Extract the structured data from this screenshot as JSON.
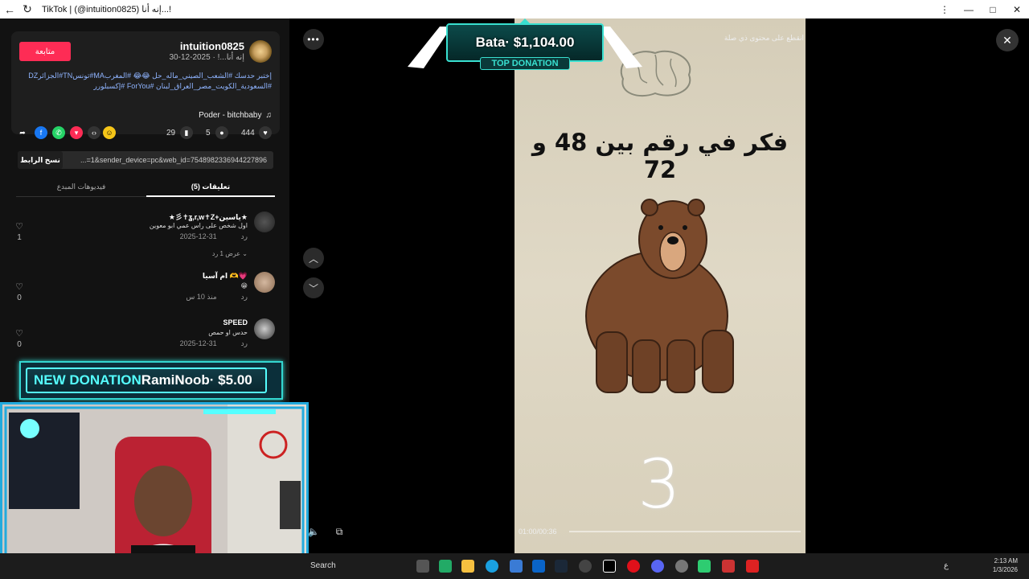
{
  "window": {
    "title": "TikTok | (@intuition0825) إنه أنا...!",
    "back": "←",
    "refresh": "↻",
    "more": "⋮",
    "min": "—",
    "max": "□",
    "close": "✕"
  },
  "post": {
    "follow_label": "متابعة",
    "username": "intuition0825",
    "date_line": "إنه أنا...! · 2025-12-30",
    "description_text": "إختبر حدسك #الشعب_الصيني_ماله_حل 😂😂 #المغربMA#تونسTN#الجزائرDZ #السعودية_الكويت_مصر_العراق_لبنان #ForYou #إكسبلورر",
    "music": "Poder - bitchbaby",
    "music_icon": "♫"
  },
  "actions": {
    "likes": "444",
    "comments": "5",
    "saves": "29",
    "icons": [
      "share-icon",
      "facebook-icon",
      "whatsapp-icon",
      "telegram-icon",
      "embed-icon",
      "emoji-icon"
    ]
  },
  "link": {
    "url": "...=1&sender_device=pc&web_id=7548982336944227896",
    "copy_label": "نسخ الرابط"
  },
  "tabs": {
    "comments": "تعليقات (5)",
    "creator_videos": "فيديوهات المبدع"
  },
  "comments": [
    {
      "name": "★彡✝ʓ,r,w✝Z+ياسين★",
      "text": "اول شخص على راس عمي ابو معوين",
      "date": "2025-12-31",
      "reply": "رد",
      "likes": "1"
    },
    {
      "name": "ام آسيا 🫶💗",
      "text": "😁",
      "date": "منذ 10 س",
      "reply": "رد",
      "likes": "0"
    },
    {
      "name": "SPEED",
      "text": "حدس او حمص",
      "date": "2025-12-31",
      "reply": "رد",
      "likes": "0"
    }
  ],
  "view_replies": "عرض 1 رد ⌄",
  "video": {
    "question": "فكر في رقم بين 48 و 72",
    "digit": "3",
    "time": "01:00/00:36",
    "notice": "انقطع على محتوى ذي صلة"
  },
  "overlay": {
    "top_donation": "Bata· $1,104.00",
    "top_label": "TOP DONATION",
    "new_donation_label": "NEW DONATION",
    "new_donation_text": "RamiNoob· $5.00"
  },
  "taskbar": {
    "search": "Search",
    "lang": "ع",
    "time": "2:13 AM",
    "date": "1/3/2026"
  }
}
